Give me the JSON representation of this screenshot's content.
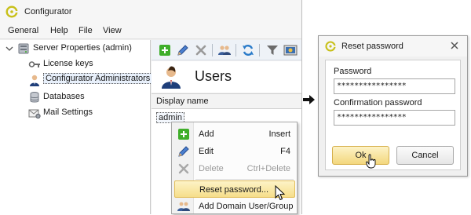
{
  "window": {
    "title": "Configurator"
  },
  "menu": [
    "General",
    "Help",
    "File",
    "View"
  ],
  "tree": {
    "root": "Server Properties (admin)",
    "items": [
      "License keys",
      "Configurator Administrators",
      "Databases",
      "Mail Settings"
    ]
  },
  "toolbar": {
    "icons": [
      "add-icon",
      "edit-icon",
      "delete-icon",
      "add-domain-user-icon",
      "refresh-icon",
      "filter-icon",
      "preview-icon"
    ]
  },
  "panel": {
    "title": "Users",
    "column_header": "Display name",
    "rows": [
      "admin"
    ]
  },
  "context_menu": {
    "items": [
      {
        "label": "Add",
        "shortcut": "Insert",
        "icon": "add-icon",
        "enabled": true
      },
      {
        "label": "Edit",
        "shortcut": "F4",
        "icon": "edit-icon",
        "enabled": true
      },
      {
        "label": "Delete",
        "shortcut": "Ctrl+Delete",
        "icon": "delete-icon",
        "enabled": false
      },
      {
        "label": "Reset password...",
        "shortcut": "",
        "icon": "",
        "enabled": true
      },
      {
        "label": "Add Domain User/Group",
        "shortcut": "",
        "icon": "add-domain-user-icon",
        "enabled": true
      }
    ]
  },
  "dialog": {
    "title": "Reset password",
    "password_label": "Password",
    "password_value": "****************",
    "confirm_label": "Confirmation password",
    "confirm_value": "****************",
    "ok_label": "Ok",
    "cancel_label": "Cancel"
  },
  "colors": {
    "accent_green": "#3fae2a",
    "highlight": "#f6de8a",
    "brand_yellow": "#c8c01a"
  }
}
